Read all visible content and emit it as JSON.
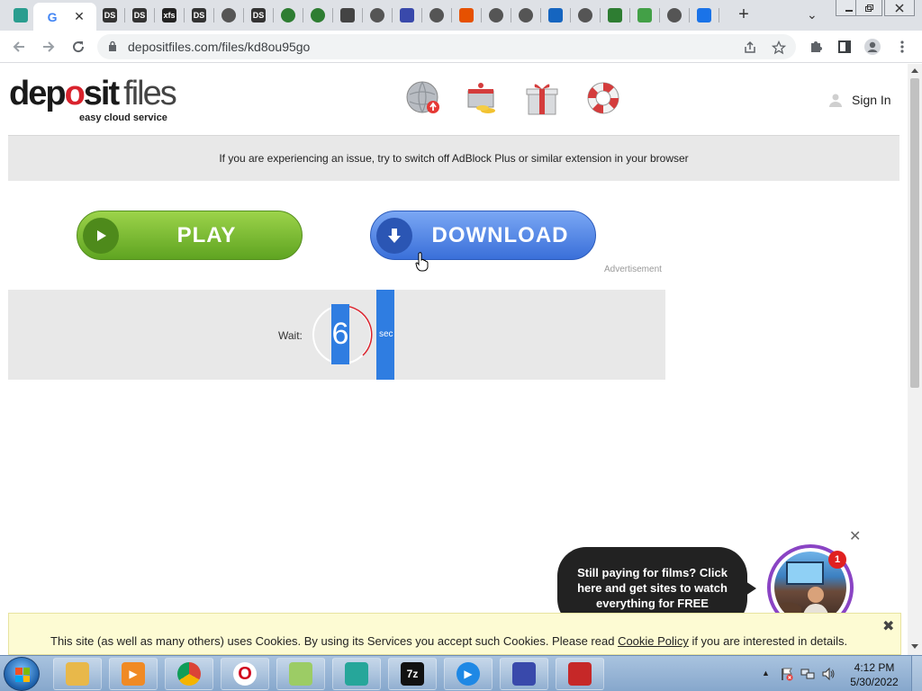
{
  "browser": {
    "url": "depositfiles.com/files/kd8ou95go",
    "tab_close_glyph": "✕",
    "new_tab_glyph": "+",
    "tab_list_glyph": "⌄",
    "tabs": [
      {
        "icon": "green-leaf-icon",
        "color": "#2a9d8f",
        "label": ""
      },
      {
        "icon": "google-icon",
        "color": "#4285f4",
        "label": "G"
      },
      {
        "icon": "ds-icon",
        "color": "#333333",
        "label": "DS"
      },
      {
        "icon": "ds-icon",
        "color": "#333333",
        "label": "DS"
      },
      {
        "icon": "xfs-icon",
        "color": "#222222",
        "label": "xfs"
      },
      {
        "icon": "ds-icon",
        "color": "#333333",
        "label": "DS"
      },
      {
        "icon": "globe-icon",
        "color": "#555555",
        "label": ""
      },
      {
        "icon": "ds-icon",
        "color": "#333333",
        "label": "DS"
      },
      {
        "icon": "play-icon",
        "color": "#2e7d32",
        "label": ""
      },
      {
        "icon": "play-icon",
        "color": "#2e7d32",
        "label": ""
      },
      {
        "icon": "leaf-icon",
        "color": "#444444",
        "label": ""
      },
      {
        "icon": "globe-icon",
        "color": "#555555",
        "label": ""
      },
      {
        "icon": "gear-icon",
        "color": "#3949ab",
        "label": ""
      },
      {
        "icon": "globe-icon",
        "color": "#555555",
        "label": ""
      },
      {
        "icon": "monkey-icon",
        "color": "#e65100",
        "label": ""
      },
      {
        "icon": "chrome-icon",
        "color": "#555555",
        "label": ""
      },
      {
        "icon": "chrome-icon",
        "color": "#555555",
        "label": ""
      },
      {
        "icon": "puzzle-icon",
        "color": "#1565c0",
        "label": ""
      },
      {
        "icon": "chrome-icon",
        "color": "#555555",
        "label": ""
      },
      {
        "icon": "recycle-icon",
        "color": "#2e7d32",
        "label": ""
      },
      {
        "icon": "recycle-icon",
        "color": "#43a047",
        "label": ""
      },
      {
        "icon": "globe-icon",
        "color": "#555555",
        "label": ""
      },
      {
        "icon": "download-icon",
        "color": "#1a73e8",
        "label": ""
      }
    ]
  },
  "site": {
    "logo_dep": "dep",
    "logo_o": "o",
    "logo_sit": "sit",
    "logo_files": "files",
    "logo_tagline": "easy cloud service",
    "sign_in": "Sign In",
    "notice": "If you are experiencing an issue, try to switch off AdBlock Plus or similar extension in your browser",
    "play_label": "PLAY",
    "download_label": "DOWNLOAD",
    "ad_label": "Advertisement",
    "wait_label": "Wait:",
    "countdown": "6",
    "sec_label": "sec"
  },
  "popup": {
    "close_glyph": "✕",
    "message": "Still paying for films? Click here and get sites to watch everything for FREE",
    "badge_count": "1"
  },
  "cookie": {
    "text_before": "This site (as well as many others) uses Cookies. By using its Services you accept such Cookies. Please read ",
    "link": "Cookie Policy",
    "text_after": " if you are interested in details.",
    "close_glyph": "✖"
  },
  "taskbar": {
    "time": "4:12 PM",
    "date": "5/30/2022",
    "apps": [
      {
        "name": "explorer",
        "icon": "folder-icon",
        "color": "#e8b84a",
        "label": ""
      },
      {
        "name": "media-player",
        "icon": "media-icon",
        "color": "#f08a24",
        "label": "▶"
      },
      {
        "name": "chrome",
        "icon": "chrome-icon",
        "color": "#db4437",
        "label": ""
      },
      {
        "name": "opera",
        "icon": "opera-icon",
        "color": "#d0021b",
        "label": "O"
      },
      {
        "name": "notes",
        "icon": "notepad-icon",
        "color": "#9ccc65",
        "label": ""
      },
      {
        "name": "app-cubes",
        "icon": "cubes-icon",
        "color": "#26a69a",
        "label": ""
      },
      {
        "name": "7zip",
        "icon": "7zip-icon",
        "color": "#111111",
        "label": "7z"
      },
      {
        "name": "player",
        "icon": "play-circle-icon",
        "color": "#1e88e5",
        "label": "▶"
      },
      {
        "name": "monitor",
        "icon": "monitor-icon",
        "color": "#3949ab",
        "label": ""
      },
      {
        "name": "game",
        "icon": "game-icon",
        "color": "#c62828",
        "label": ""
      }
    ]
  }
}
